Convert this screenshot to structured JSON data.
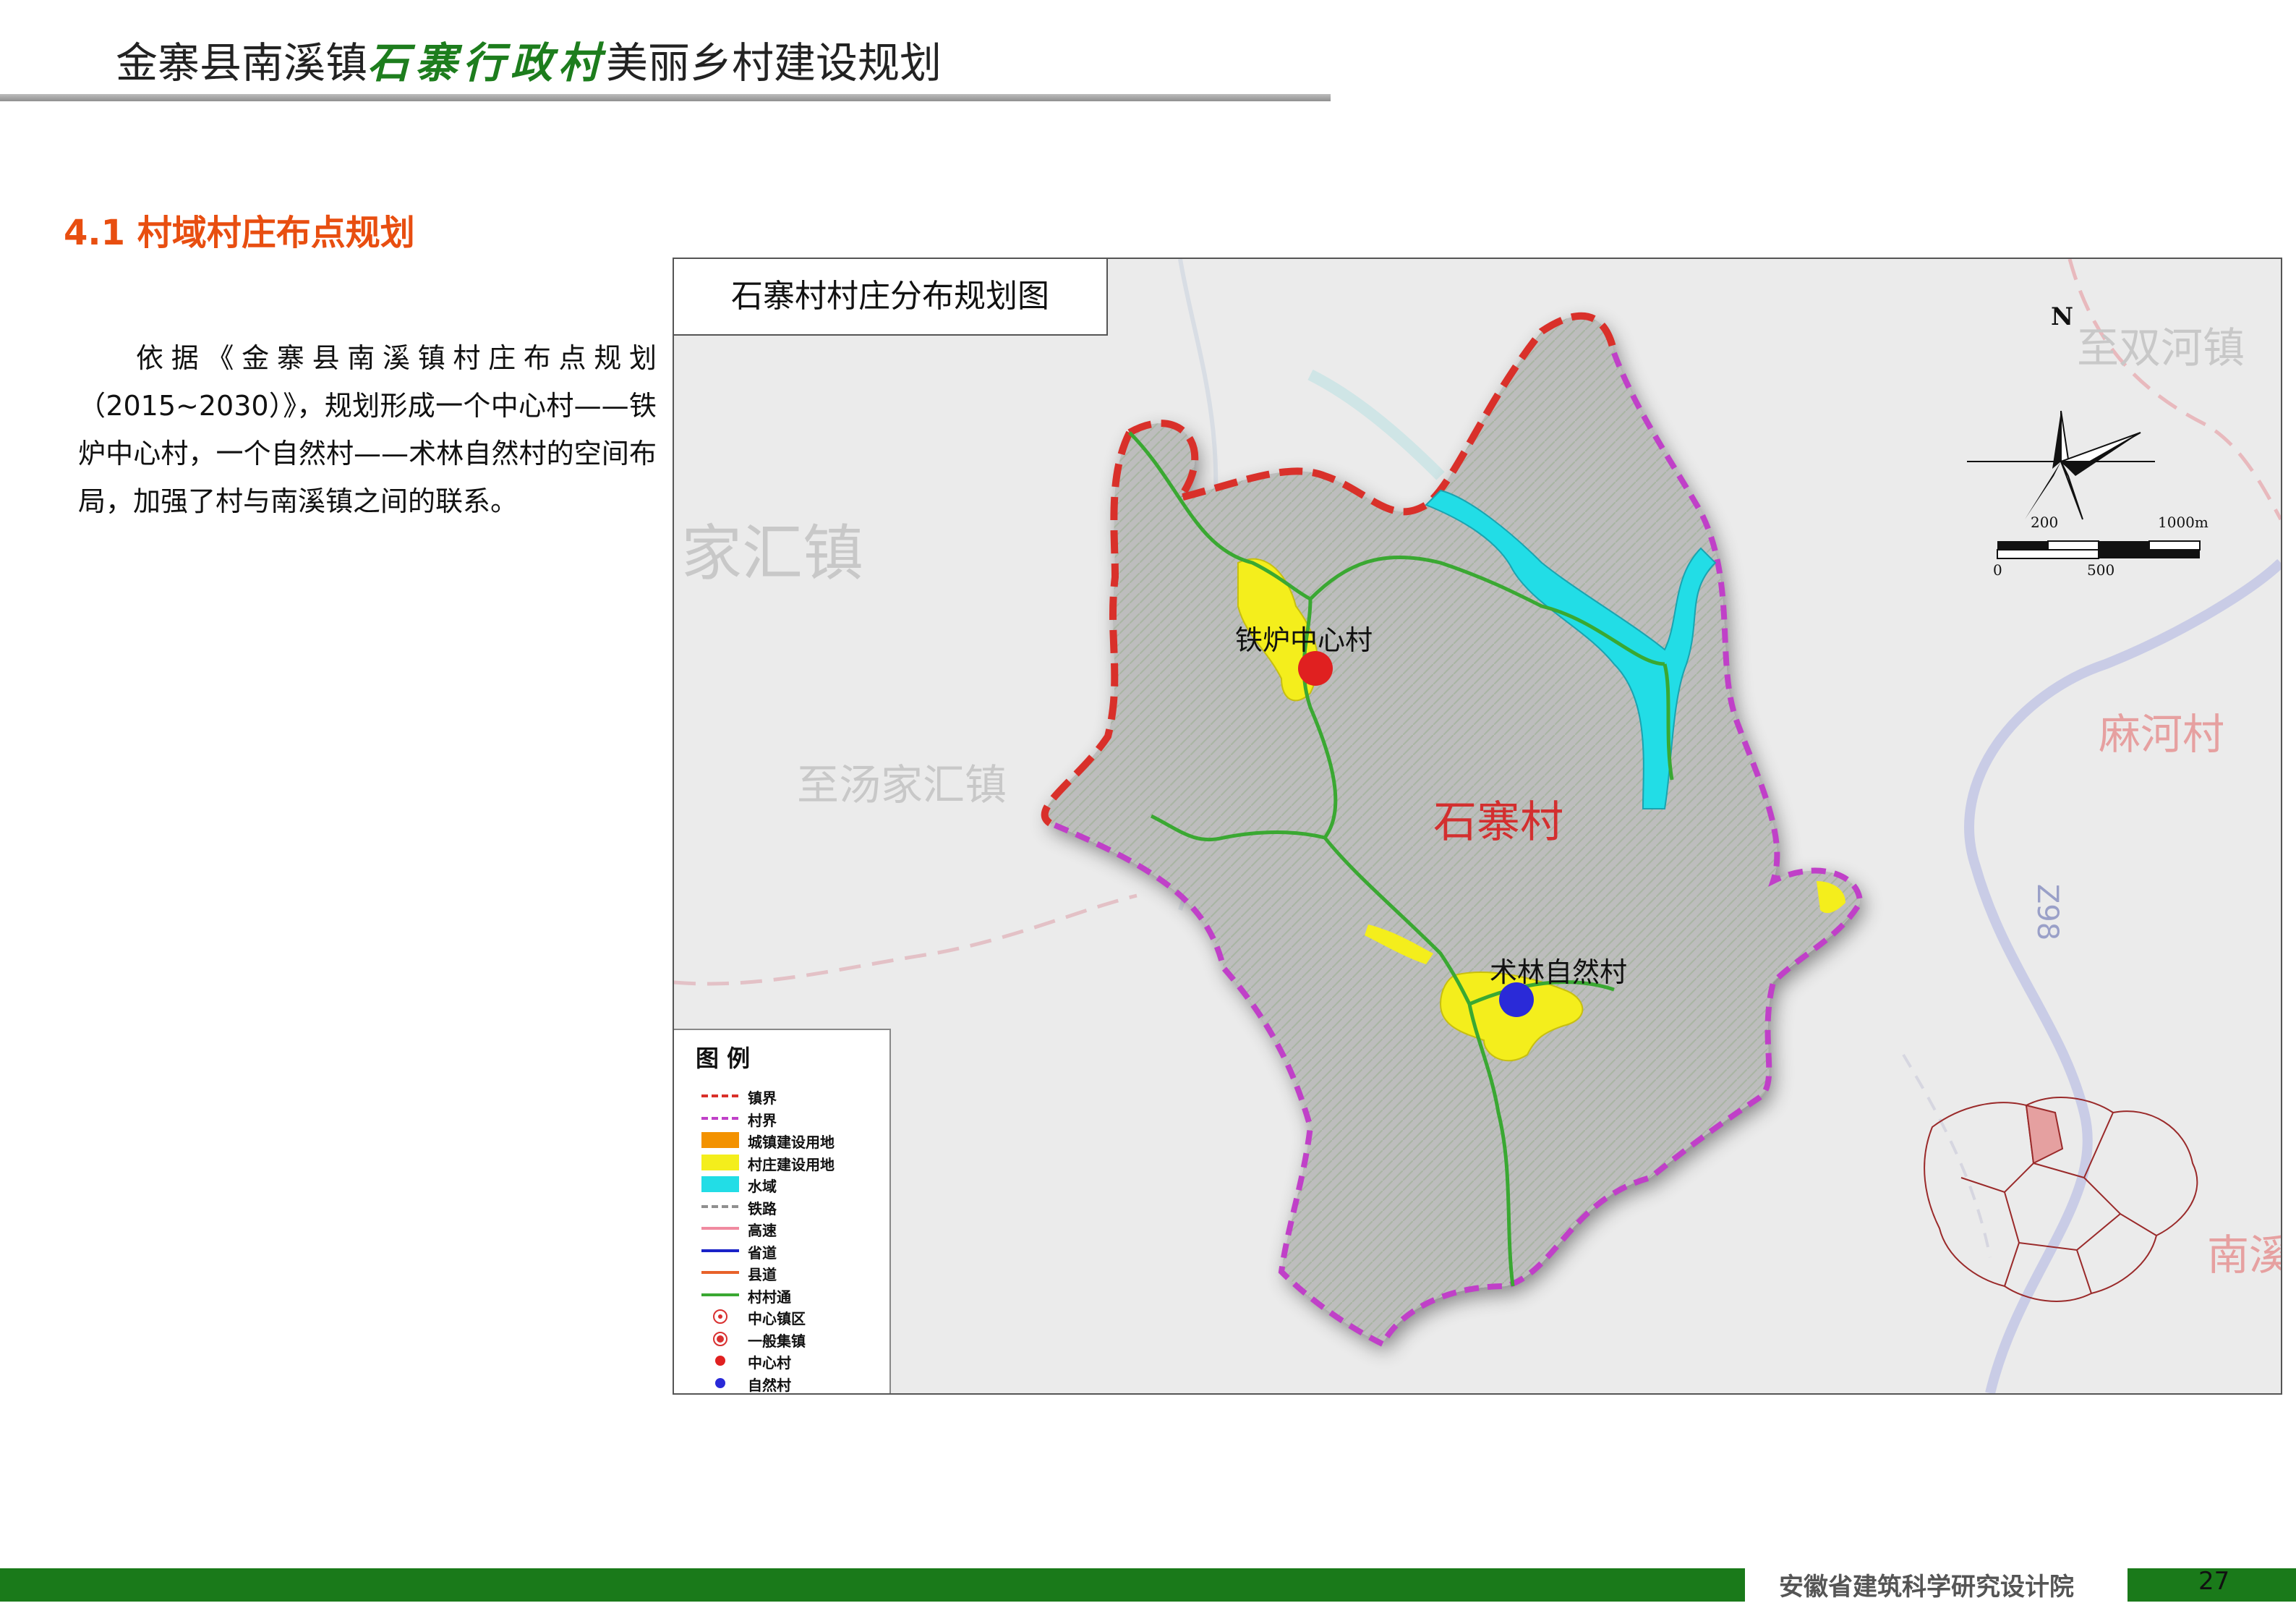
{
  "header": {
    "title_prefix": "金寨县南溪镇",
    "title_highlight": "石寨行政村",
    "title_suffix": "美丽乡村建设规划"
  },
  "section": {
    "title": "4.1 村域村庄布点规划",
    "paragraph": "依据《金寨县南溪镇村庄布点规划（2015~2030）》，规划形成一个中心村——铁炉中心村，一个自然村——术林自然村的空间布局，加强了村与南溪镇之间的联系。"
  },
  "map": {
    "title": "石寨村村庄分布规划图",
    "village_name": "石寨村",
    "center_village": "铁炉中心村",
    "natural_village": "术林自然村",
    "context_labels": {
      "tangjiahui": "家汇镇",
      "to_tangjiahui": "至汤家汇镇",
      "to_shuanghe": "至双河镇",
      "mahe": "麻河村",
      "nanxi": "南溪",
      "road_code": "Z98"
    },
    "compass": "N",
    "scale": {
      "top_left": "200",
      "top_right": "1000m",
      "bottom_left": "0",
      "bottom_mid": "500"
    },
    "legend": {
      "title": "图 例",
      "items": [
        {
          "label": "镇界",
          "kind": "dash",
          "color": "#d9302a"
        },
        {
          "label": "村界",
          "kind": "dash",
          "color": "#c040c8"
        },
        {
          "label": "城镇建设用地",
          "kind": "fill",
          "color": "#f39200"
        },
        {
          "label": "村庄建设用地",
          "kind": "fill",
          "color": "#f4ee1c"
        },
        {
          "label": "水域",
          "kind": "fill",
          "color": "#22dde6"
        },
        {
          "label": "铁路",
          "kind": "dash",
          "color": "#909090"
        },
        {
          "label": "高速",
          "kind": "line",
          "color": "#f08aa0"
        },
        {
          "label": "省道",
          "kind": "line",
          "color": "#1a22c8"
        },
        {
          "label": "县道",
          "kind": "line",
          "color": "#e8622a"
        },
        {
          "label": "村村通",
          "kind": "line",
          "color": "#3aa832"
        },
        {
          "label": "中心镇区",
          "kind": "target",
          "color": "#d93030"
        },
        {
          "label": "一般集镇",
          "kind": "target2",
          "color": "#d93030"
        },
        {
          "label": "中心村",
          "kind": "dot",
          "color": "#e02020"
        },
        {
          "label": "自然村",
          "kind": "dot",
          "color": "#2a2ad8"
        }
      ]
    }
  },
  "footer": {
    "org": "安徽省建筑科学研究设计院",
    "page": "27"
  }
}
